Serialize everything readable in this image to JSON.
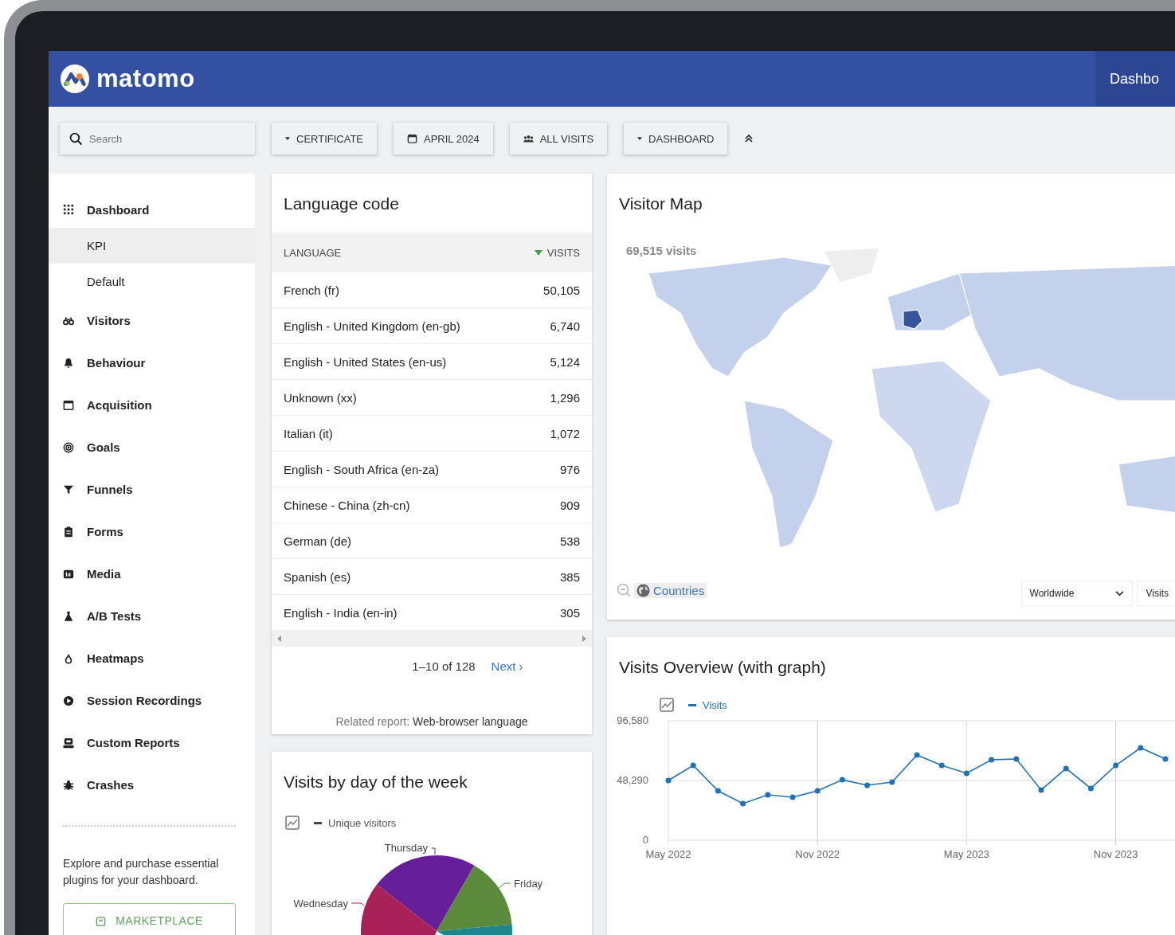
{
  "header": {
    "logo_text": "matomo",
    "nav_item": "Dashbo"
  },
  "toolbar": {
    "search": {
      "placeholder": "Search"
    },
    "buttons": [
      {
        "label": "CERTIFICATE",
        "kind": "dropdown"
      },
      {
        "label": "APRIL 2024",
        "kind": "calendar"
      },
      {
        "label": "ALL VISITS",
        "kind": "segment"
      },
      {
        "label": "DASHBOARD",
        "kind": "dropdown"
      }
    ]
  },
  "sidebar": {
    "items": [
      {
        "label": "Dashboard",
        "selected": false,
        "children": [
          {
            "label": "KPI",
            "selected": true
          },
          {
            "label": "Default",
            "selected": false
          }
        ]
      },
      {
        "label": "Visitors",
        "selected": false
      },
      {
        "label": "Behaviour",
        "selected": false
      },
      {
        "label": "Acquisition",
        "selected": false
      },
      {
        "label": "Goals",
        "selected": false
      },
      {
        "label": "Funnels",
        "selected": false
      },
      {
        "label": "Forms",
        "selected": false
      },
      {
        "label": "Media",
        "selected": false
      },
      {
        "label": "A/B Tests",
        "selected": false
      },
      {
        "label": "Heatmaps",
        "selected": false
      },
      {
        "label": "Session Recordings",
        "selected": false
      },
      {
        "label": "Custom Reports",
        "selected": false
      },
      {
        "label": "Crashes",
        "selected": false
      }
    ],
    "promo_text": "Explore and purchase essential plugins for your dashboard.",
    "marketplace_button": "MARKETPLACE"
  },
  "language_card": {
    "title": "Language code",
    "columns": [
      {
        "label": "LANGUAGE",
        "sorted": false
      },
      {
        "label": "VISITS",
        "sorted": true
      }
    ],
    "rows": [
      {
        "language": "French (fr)",
        "visits": "50,105"
      },
      {
        "language": "English - United Kingdom (en-gb)",
        "visits": "6,740"
      },
      {
        "language": "English - United States (en-us)",
        "visits": "5,124"
      },
      {
        "language": "Unknown (xx)",
        "visits": "1,296"
      },
      {
        "language": "Italian (it)",
        "visits": "1,072"
      },
      {
        "language": "English - South Africa (en-za)",
        "visits": "976"
      },
      {
        "language": "Chinese - China (zh-cn)",
        "visits": "909"
      },
      {
        "language": "German (de)",
        "visits": "538"
      },
      {
        "language": "Spanish (es)",
        "visits": "385"
      },
      {
        "language": "English - India (en-in)",
        "visits": "305"
      }
    ],
    "pagination": {
      "range": "1–10 of 128",
      "next": "Next ›"
    },
    "related_report": {
      "label": "Related report:",
      "link": "Web-browser language"
    }
  },
  "weekday_card": {
    "title": "Visits by day of the week",
    "legend": "Unique visitors",
    "slice_labels": [
      "Thursday",
      "Friday",
      "Wednesday"
    ]
  },
  "map_card": {
    "title": "Visitor Map",
    "total": "69,515 visits",
    "level_link": "Countries",
    "region_select": "Worldwide",
    "metric_select": "Visits"
  },
  "overview_card": {
    "title": "Visits Overview (with graph)",
    "chart_data": {
      "type": "line",
      "categories": [
        "May 2022",
        null,
        null,
        null,
        null,
        null,
        "Nov 2022",
        null,
        null,
        null,
        null,
        null,
        "May 2023",
        null,
        null,
        null,
        null,
        null,
        "Nov 2023",
        null,
        null
      ],
      "grid": true,
      "series": [
        {
          "name": "Visits",
          "color": "#2171b5",
          "marker": true,
          "values": [
            48300,
            60500,
            39900,
            29600,
            36700,
            34800,
            39900,
            48900,
            44400,
            47000,
            68900,
            60500,
            54100,
            65000,
            65700,
            40600,
            58000,
            41900,
            60500,
            74700,
            65700
          ]
        }
      ],
      "yticks": [
        0,
        {
          "value": 48290,
          "label": "48,290"
        },
        {
          "value": 96580,
          "label": "96,580"
        }
      ],
      "ylim": [
        0,
        96580
      ]
    }
  }
}
